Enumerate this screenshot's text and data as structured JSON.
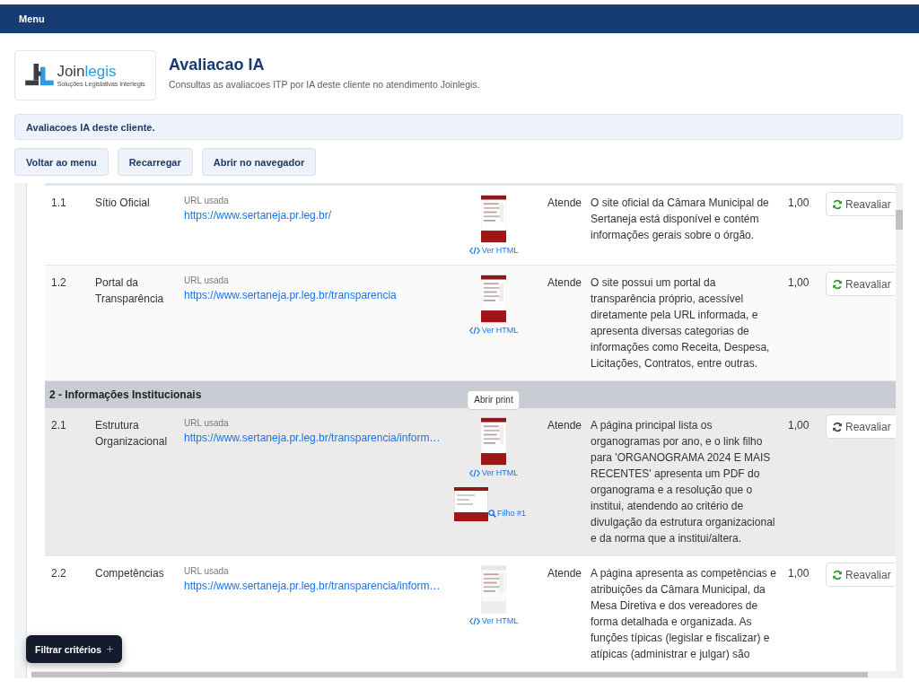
{
  "topbar": {
    "menu": "Menu"
  },
  "header": {
    "logo": {
      "brand_dark": "Join",
      "brand_accent": "legis",
      "tagline": "Soluções Legislativas Interlegis"
    },
    "title": "Avaliacao IA",
    "subtitle": "Consultas as avaliacoes ITP por IA deste cliente no atendimento Joinlegis."
  },
  "info": "Avaliacoes IA deste cliente.",
  "buttons": [
    "Voltar ao menu",
    "Recarregar",
    "Abrir no navegador"
  ],
  "rows": [
    {
      "kind": "item",
      "num": "1.1",
      "name": "Sítio Oficial",
      "url_label": "URL usada",
      "url": "https://www.sertaneja.pr.leg.br/",
      "html_link": "Ver HTML",
      "status": "Atende",
      "description": "O site oficial da Câmara Municipal de Sertaneja está disponível e contém informações gerais sobre o órgão.",
      "score": "1,00",
      "action": "Reavaliar",
      "hover": false
    },
    {
      "kind": "item",
      "num": "1.2",
      "name": "Portal da Transparência",
      "url_label": "URL usada",
      "url": "https://www.sertaneja.pr.leg.br/transparencia",
      "html_link": "Ver HTML",
      "status": "Atende",
      "description": "O site possui um portal da transparência próprio, acessível diretamente pela URL informada, e apresenta diversas categorias de informações como Receita, Despesa, Licitações, Contratos, entre outras.",
      "score": "1,00",
      "action": "Reavaliar",
      "hover": false
    },
    {
      "kind": "section",
      "title": "2 - Informações Institucionais"
    },
    {
      "kind": "item",
      "num": "2.1",
      "name": "Estrutura Organizacional",
      "url_label": "URL usada",
      "url": "https://www.sertaneja.pr.leg.br/transparencia/inform…",
      "html_link": "Ver HTML",
      "tooltip": "Abrir print",
      "child": "Filho #1",
      "status": "Atende",
      "description": "A página principal lista os organogramas por ano, e o link filho para 'ORGANOGRAMA 2024 E MAIS RECENTES' apresenta um PDF do organograma e a resolução que o institui, atendendo ao critério de divulgação da estrutura organizacional e da norma que a institui/altera.",
      "score": "1,00",
      "action": "Reavaliar",
      "hover": true
    },
    {
      "kind": "item",
      "num": "2.2",
      "name": "Competências",
      "url_label": "URL usada",
      "url": "https://www.sertaneja.pr.leg.br/transparencia/inform…",
      "html_link": "Ver HTML",
      "status": "Atende",
      "description": "A página apresenta as competências e atribuições da Câmara Municipal, da Mesa Diretiva e dos vereadores de forma detalhada e organizada. As funções típicas (legislar e fiscalizar) e atípicas (administrar e julgar) são",
      "score": "1,00",
      "action": "Reavaliar",
      "hover": false
    }
  ],
  "filter_button": "Filtrar critérios"
}
